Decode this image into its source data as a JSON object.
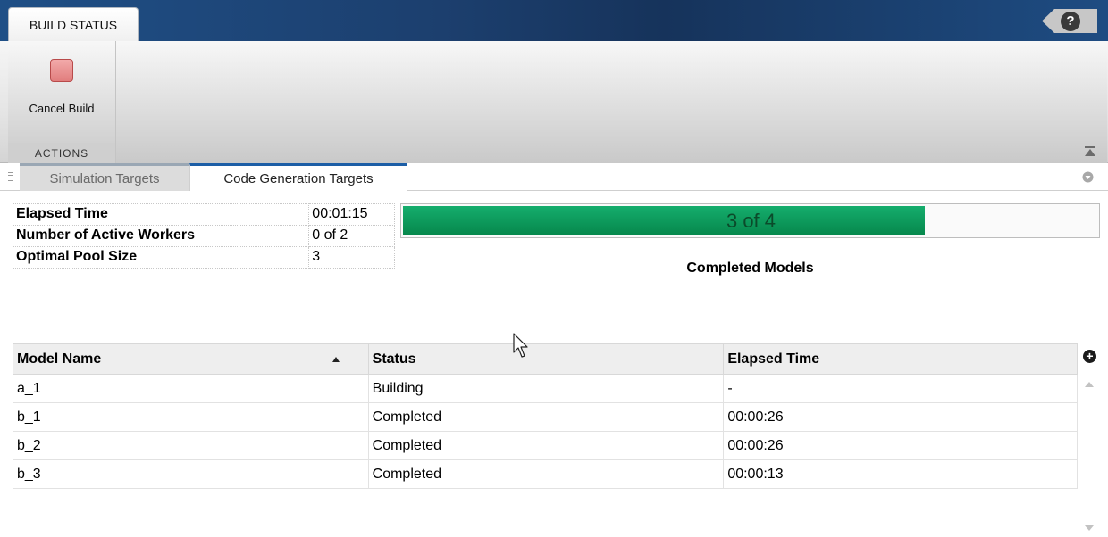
{
  "ribbon": {
    "tab_label": "BUILD STATUS",
    "help_label": "?",
    "cancel_button_label": "Cancel Build",
    "section_label": "ACTIONS"
  },
  "doc_tabs": [
    {
      "label": "Simulation Targets",
      "active": false
    },
    {
      "label": "Code Generation Targets",
      "active": true
    }
  ],
  "summary": [
    {
      "label": "Elapsed Time",
      "value": "00:01:15"
    },
    {
      "label": "Number of Active Workers",
      "value": "0 of 2"
    },
    {
      "label": "Optimal Pool Size",
      "value": "3"
    }
  ],
  "progress": {
    "text": "3 of 4",
    "completed": 3,
    "total": 4,
    "label": "Completed Models",
    "fill_color": "#0f9e5e"
  },
  "models_table": {
    "columns": [
      "Model Name",
      "Status",
      "Elapsed Time"
    ],
    "sort_column": "Model Name",
    "sort_direction": "ascending",
    "add_column_label": "+",
    "rows": [
      {
        "name": "a_1",
        "status": "Building",
        "elapsed": "-"
      },
      {
        "name": "b_1",
        "status": "Completed",
        "elapsed": "00:00:26"
      },
      {
        "name": "b_2",
        "status": "Completed",
        "elapsed": "00:00:26"
      },
      {
        "name": "b_3",
        "status": "Completed",
        "elapsed": "00:00:13"
      }
    ]
  },
  "colors": {
    "title_bar": "#1c3f6e",
    "active_tab_accent": "#1d5ea6",
    "stop_icon": "#e17d7d"
  }
}
